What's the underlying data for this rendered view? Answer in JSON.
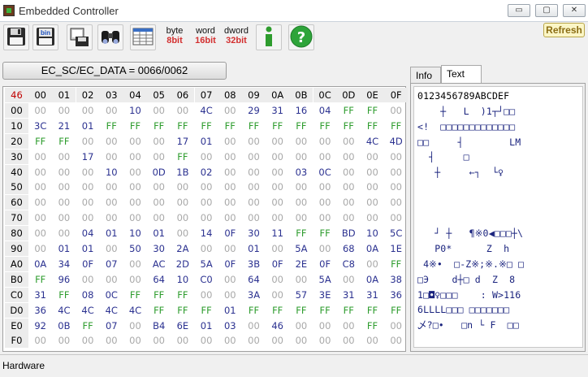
{
  "window": {
    "title": "Embedded Controller",
    "minimize_glyph": "▭",
    "maximize_glyph": "▢",
    "close_glyph": "✕"
  },
  "toolbar": {
    "icons": [
      "floppy-save-icon",
      "save-bin-icon",
      "network-drive-icon",
      "binoculars-icon",
      "grid-table-icon",
      "info-icon",
      "help-icon"
    ],
    "byte": {
      "l1": "byte",
      "l2": "8bit",
      "color": "#d32f2f"
    },
    "word": {
      "l1": "word",
      "l2": "16bit",
      "color": "#d32f2f"
    },
    "dword": {
      "l1": "dword",
      "l2": "32bit",
      "color": "#d32f2f"
    },
    "refresh_label": "Refresh"
  },
  "ec_button": "EC_SC/EC_DATA = 0066/0062",
  "grid": {
    "corner": "46",
    "col_headers": [
      "00",
      "01",
      "02",
      "03",
      "04",
      "05",
      "06",
      "07",
      "08",
      "09",
      "0A",
      "0B",
      "0C",
      "0D",
      "0E",
      "0F"
    ],
    "rows": [
      {
        "addr": "00",
        "cells": [
          "00",
          "00",
          "00",
          "00",
          "10",
          "00",
          "00",
          "4C",
          "00",
          "29",
          "31",
          "16",
          "04",
          "FF",
          "FF",
          "00"
        ]
      },
      {
        "addr": "10",
        "cells": [
          "3C",
          "21",
          "01",
          "FF",
          "FF",
          "FF",
          "FF",
          "FF",
          "FF",
          "FF",
          "FF",
          "FF",
          "FF",
          "FF",
          "FF",
          "FF"
        ]
      },
      {
        "addr": "20",
        "cells": [
          "FF",
          "FF",
          "00",
          "00",
          "00",
          "00",
          "17",
          "01",
          "00",
          "00",
          "00",
          "00",
          "00",
          "00",
          "4C",
          "4D"
        ]
      },
      {
        "addr": "30",
        "cells": [
          "00",
          "00",
          "17",
          "00",
          "00",
          "00",
          "FF",
          "00",
          "00",
          "00",
          "00",
          "00",
          "00",
          "00",
          "00",
          "00"
        ]
      },
      {
        "addr": "40",
        "cells": [
          "00",
          "00",
          "00",
          "10",
          "00",
          "0D",
          "1B",
          "02",
          "00",
          "00",
          "00",
          "03",
          "0C",
          "00",
          "00",
          "00"
        ]
      },
      {
        "addr": "50",
        "cells": [
          "00",
          "00",
          "00",
          "00",
          "00",
          "00",
          "00",
          "00",
          "00",
          "00",
          "00",
          "00",
          "00",
          "00",
          "00",
          "00"
        ]
      },
      {
        "addr": "60",
        "cells": [
          "00",
          "00",
          "00",
          "00",
          "00",
          "00",
          "00",
          "00",
          "00",
          "00",
          "00",
          "00",
          "00",
          "00",
          "00",
          "00"
        ]
      },
      {
        "addr": "70",
        "cells": [
          "00",
          "00",
          "00",
          "00",
          "00",
          "00",
          "00",
          "00",
          "00",
          "00",
          "00",
          "00",
          "00",
          "00",
          "00",
          "00"
        ]
      },
      {
        "addr": "80",
        "cells": [
          "00",
          "00",
          "04",
          "01",
          "10",
          "01",
          "00",
          "14",
          "0F",
          "30",
          "11",
          "FF",
          "FF",
          "BD",
          "10",
          "5C"
        ]
      },
      {
        "addr": "90",
        "cells": [
          "00",
          "01",
          "01",
          "00",
          "50",
          "30",
          "2A",
          "00",
          "00",
          "01",
          "00",
          "5A",
          "00",
          "68",
          "0A",
          "1E"
        ]
      },
      {
        "addr": "A0",
        "cells": [
          "0A",
          "34",
          "0F",
          "07",
          "00",
          "AC",
          "2D",
          "5A",
          "0F",
          "3B",
          "0F",
          "2E",
          "0F",
          "C8",
          "00",
          "FF"
        ]
      },
      {
        "addr": "B0",
        "cells": [
          "FF",
          "96",
          "00",
          "00",
          "00",
          "64",
          "10",
          "C0",
          "00",
          "64",
          "00",
          "00",
          "5A",
          "00",
          "0A",
          "38"
        ]
      },
      {
        "addr": "C0",
        "cells": [
          "31",
          "FF",
          "08",
          "0C",
          "FF",
          "FF",
          "FF",
          "00",
          "00",
          "3A",
          "00",
          "57",
          "3E",
          "31",
          "31",
          "36"
        ]
      },
      {
        "addr": "D0",
        "cells": [
          "36",
          "4C",
          "4C",
          "4C",
          "4C",
          "FF",
          "FF",
          "FF",
          "01",
          "FF",
          "FF",
          "FF",
          "FF",
          "FF",
          "FF",
          "FF"
        ]
      },
      {
        "addr": "E0",
        "cells": [
          "92",
          "0B",
          "FF",
          "07",
          "00",
          "B4",
          "6E",
          "01",
          "03",
          "00",
          "46",
          "00",
          "00",
          "00",
          "FF",
          "00"
        ]
      },
      {
        "addr": "F0",
        "cells": [
          "00",
          "00",
          "00",
          "00",
          "00",
          "00",
          "00",
          "00",
          "00",
          "00",
          "00",
          "00",
          "00",
          "00",
          "00",
          "00"
        ]
      }
    ]
  },
  "tabs": [
    {
      "label": "Info"
    },
    {
      "label": "Text"
    }
  ],
  "text_panel": {
    "header": "0123456789ABCDEF",
    "rows": [
      "    ┼   L  )1┬┘□□",
      "<!  □□□□□□□□□□□□□",
      "□□     ┤        LM",
      "  ┤     □        ",
      "   ┼     ←┐  └♀  ",
      "                 ",
      "                 ",
      "                 ",
      "   ┘ ┼   ¶※0◀□□□┼\\",
      "   P0*      Z  h ",
      " 4※•  □-Z※;※.※□ □",
      "□Э    d┼□ d  Z  8",
      "1□◘♀□□□    : W>116",
      "6LLLL□□□ □□□□□□□",
      "乄?□•   □n └ F  □□",
      "                 "
    ]
  },
  "status": "Hardware"
}
